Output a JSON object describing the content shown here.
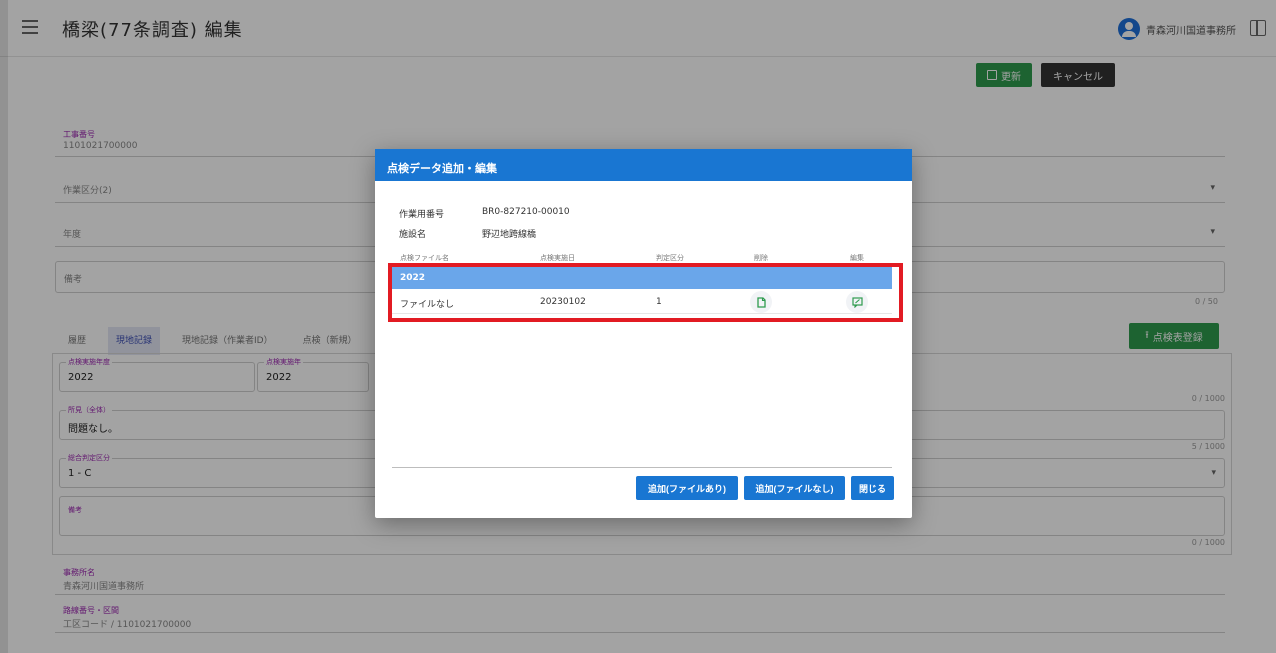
{
  "appbar": {
    "title": "橋梁(77条調査)  編集",
    "user_name": "青森河川国道事務所"
  },
  "toolbar": {
    "update_label": "更新",
    "cancel_label": "キャンセル"
  },
  "form": {
    "field1_label": "工事番号",
    "field1_value": "1101021700000",
    "field2_label": "",
    "field2_value": "作業区分(2)",
    "field3_value": "年度",
    "field4_value": "備考",
    "field4_counter": "0 / 50",
    "footer1_label": "事務所名",
    "footer1_value": "青森河川国道事務所",
    "footer2_label": "路線番号・区間",
    "footer2_value": "工区コード / 1101021700000"
  },
  "tabs": [
    "履歴",
    "現地記録",
    "現地記録（作業者ID）",
    "点検（新規）"
  ],
  "register_button": "点検表登録",
  "inspect_panel": {
    "year_label": "点検実施年度",
    "year_value": "2022",
    "year2_label": "点検実施年",
    "year2_value": "2022",
    "remarks_label": "所見（全体）",
    "remarks_value": "問題なし。",
    "remarks_counter": "5 / 1000",
    "judge_label": "総合判定区分",
    "judge_value": "1 - C",
    "extra_label": "備考",
    "extra_counter": "0 / 1000",
    "top_counter": "0 / 1000"
  },
  "dialog": {
    "title": "点検データ追加・編集",
    "work_no_label": "作業用番号",
    "work_no_value": "BR0-827210-00010",
    "facility_label": "施設名",
    "facility_value": "野辺地跨線橋",
    "columns": [
      "点検ファイル名",
      "点検実施日",
      "判定区分",
      "削除",
      "編集"
    ],
    "group_label": "2022",
    "row": {
      "file": "ファイルなし",
      "date": "20230102",
      "judge": "1"
    },
    "buttons": {
      "add_with_file": "追加(ファイルあり)",
      "add_without_file": "追加(ファイルなし)",
      "close": "閉じる"
    }
  }
}
